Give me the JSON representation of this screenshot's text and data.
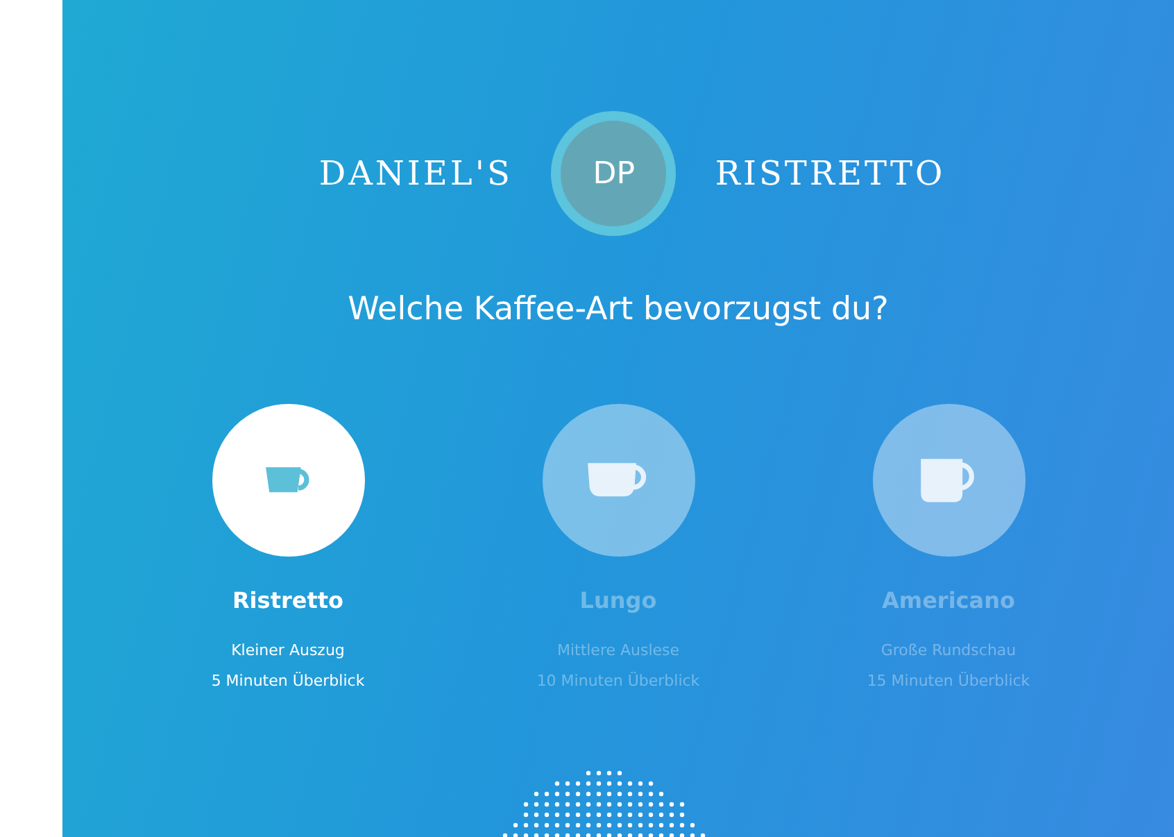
{
  "header": {
    "left": "DANIEL'S",
    "avatar": "DP",
    "right": "RISTRETTO"
  },
  "question": "Welche Kaffee-Art bevorzugst du?",
  "options": [
    {
      "kind": "espresso",
      "name": "Ristretto",
      "lines": [
        "Kleiner Auszug",
        "5 Minuten Überblick"
      ],
      "selected": true
    },
    {
      "kind": "cup",
      "name": "Lungo",
      "lines": [
        "Mittlere Auslese",
        "10 Minuten Überblick"
      ],
      "selected": false
    },
    {
      "kind": "mug",
      "name": "Americano",
      "lines": [
        "Große Rundschau",
        "15 Minuten Überblick"
      ],
      "selected": false
    }
  ]
}
